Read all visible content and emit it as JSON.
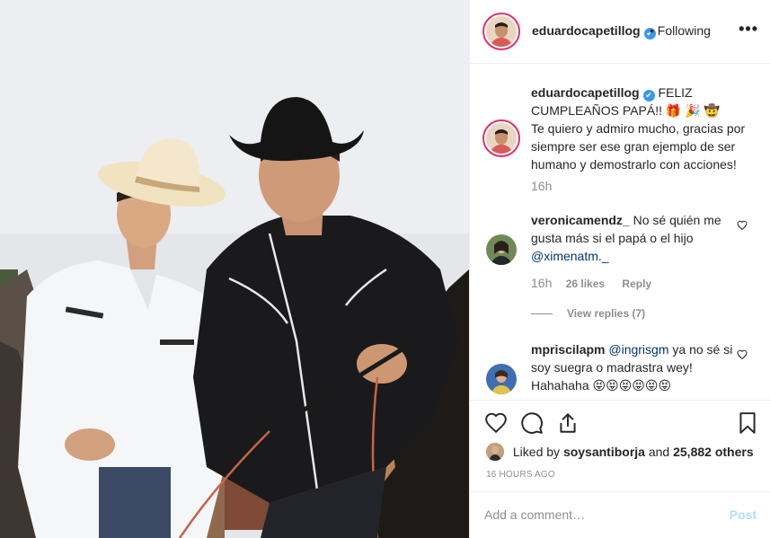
{
  "post": {
    "username": "eduardocapetillog",
    "verified_glyph": "✔",
    "separator": "•",
    "follow_status": "Following",
    "more_glyph": "•••"
  },
  "caption": {
    "username": "eduardocapetillog",
    "text_line1": "FELIZ CUMPLEAÑOS PAPÁ!! 🎁 🎉 🤠",
    "text_line2": "Te quiero y admiro mucho, gracias por siempre ser ese gran ejemplo de ser humano y demostrarlo con acciones!",
    "time": "16h"
  },
  "comments": [
    {
      "username": "veronicamendz_",
      "text": "No sé quién me gusta más si el papá o el hijo",
      "mention": "@ximenatm._",
      "time": "16h",
      "likes": "26 likes",
      "reply_label": "Reply",
      "view_replies": "View replies (7)"
    },
    {
      "username": "mpriscilapm",
      "mention": "@ingrisgm",
      "text": "ya no sé si soy suegra o madrastra wey! Hahahaha 😝😝😝😝😝😝"
    }
  ],
  "likes": {
    "prefix": "Liked by",
    "user": "soysantiborja",
    "joiner": "and",
    "count": "25,882 others"
  },
  "timestamp": "16 HOURS AGO",
  "comment_box": {
    "placeholder": "Add a comment…",
    "post_label": "Post"
  },
  "icons": [
    "heart-icon",
    "comment-icon",
    "share-icon",
    "bookmark-icon",
    "verified-badge-icon",
    "more-options-icon"
  ],
  "colors": {
    "accent": "#3897f0",
    "mention": "#00376b",
    "muted": "#8e8e8e",
    "post_disabled": "#b2dffc",
    "story_ring": "#e1306c"
  }
}
